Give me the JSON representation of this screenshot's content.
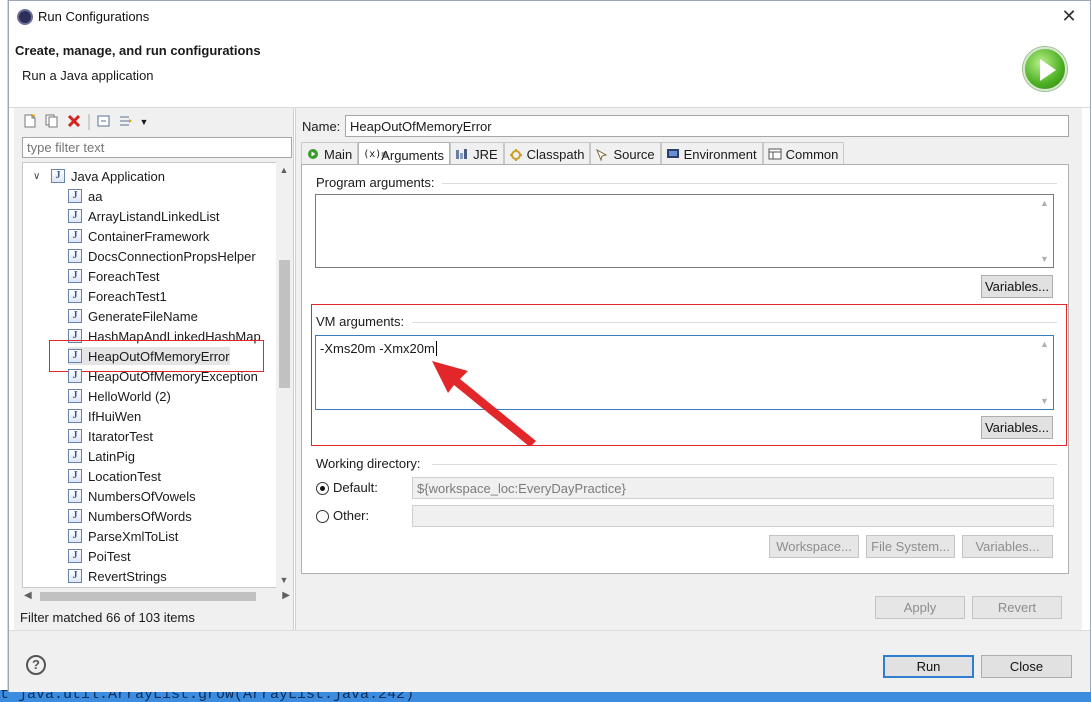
{
  "window": {
    "title": "Run Configurations",
    "close_glyph": "✕"
  },
  "header": {
    "title": "Create, manage, and run configurations",
    "subtitle": "Run a Java application"
  },
  "left_panel": {
    "filter_placeholder": "type filter text",
    "root_label": "Java Application",
    "items": [
      "aa",
      "ArrayListandLinkedList",
      "ContainerFramework",
      "DocsConnectionPropsHelper",
      "ForeachTest",
      "ForeachTest1",
      "GenerateFileName",
      "HashMapAndLinkedHashMap",
      "HeapOutOfMemoryError",
      "HeapOutOfMemoryException",
      "HelloWorld (2)",
      "IfHuiWen",
      "ItaratorTest",
      "LatinPig",
      "LocationTest",
      "NumbersOfVowels",
      "NumbersOfWords",
      "ParseXmlToList",
      "PoiTest",
      "RevertStrings"
    ],
    "selected_item": "HeapOutOfMemoryError",
    "status": "Filter matched 66 of 103 items"
  },
  "right_panel": {
    "name_label": "Name:",
    "name_value": "HeapOutOfMemoryError",
    "tabs": [
      {
        "label": "Main",
        "icon": "main-tab-icon"
      },
      {
        "label": "Arguments",
        "icon": "arguments-tab-icon"
      },
      {
        "label": "JRE",
        "icon": "jre-tab-icon"
      },
      {
        "label": "Classpath",
        "icon": "classpath-tab-icon"
      },
      {
        "label": "Source",
        "icon": "source-tab-icon"
      },
      {
        "label": "Environment",
        "icon": "environment-tab-icon"
      },
      {
        "label": "Common",
        "icon": "common-tab-icon"
      }
    ],
    "active_tab": "Arguments",
    "program_args_label": "Program arguments:",
    "program_args_value": "",
    "variables_label": "Variables...",
    "vm_args_label": "VM arguments:",
    "vm_args_value": "-Xms20m -Xmx20m",
    "working_dir_label": "Working directory:",
    "default_label": "Default:",
    "default_value": "${workspace_loc:EveryDayPractice}",
    "other_label": "Other:",
    "workspace_btn": "Workspace...",
    "filesystem_btn": "File System...",
    "variables_btn": "Variables...",
    "apply_label": "Apply",
    "revert_label": "Revert"
  },
  "footer": {
    "run_label": "Run",
    "close_label": "Close",
    "help_glyph": "?"
  },
  "background": {
    "bottom_text": "t java.util.ArrayList.grow(ArrayList.java:242)"
  },
  "colors": {
    "annotation_red": "#e2262a",
    "default_button_border": "#2f7fd0"
  }
}
